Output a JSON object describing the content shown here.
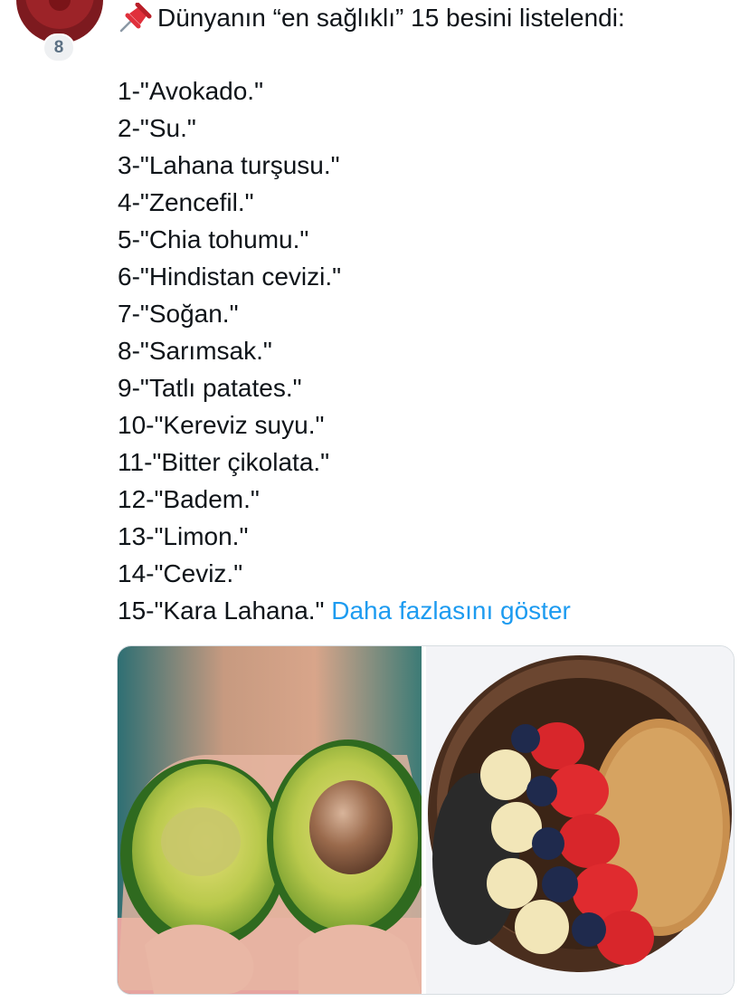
{
  "post": {
    "avatar_badge": "8",
    "pin_icon": "pushpin-icon",
    "headline": "Dünyanın “en sağlıklı” 15 besini listelendi:",
    "items": [
      "1-\"Avokado.\"",
      "2-\"Su.\"",
      "3-\"Lahana turşusu.\"",
      "4-\"Zencefil.\"",
      "5-\"Chia tohumu.\"",
      "6-\"Hindistan cevizi.\"",
      "7-\"Soğan.\"",
      "8-\"Sarımsak.\"",
      "9-\"Tatlı patates.\"",
      "10-\"Kereviz suyu.\"",
      "11-\"Bitter çikolata.\"",
      "12-\"Badem.\"",
      "13-\"Limon.\"",
      "14-\"Ceviz.\""
    ],
    "last_item": "15-\"Kara Lahana.\"",
    "show_more": "Daha fazlasını göster"
  },
  "media": {
    "images": [
      "avocado-halves-photo",
      "acai-bowl-photo"
    ]
  },
  "colors": {
    "link": "#1d9bf0",
    "text": "#0f1419",
    "badge_bg": "#eef0f2",
    "badge_text": "#5b7083",
    "avatar": "#9c2328"
  }
}
